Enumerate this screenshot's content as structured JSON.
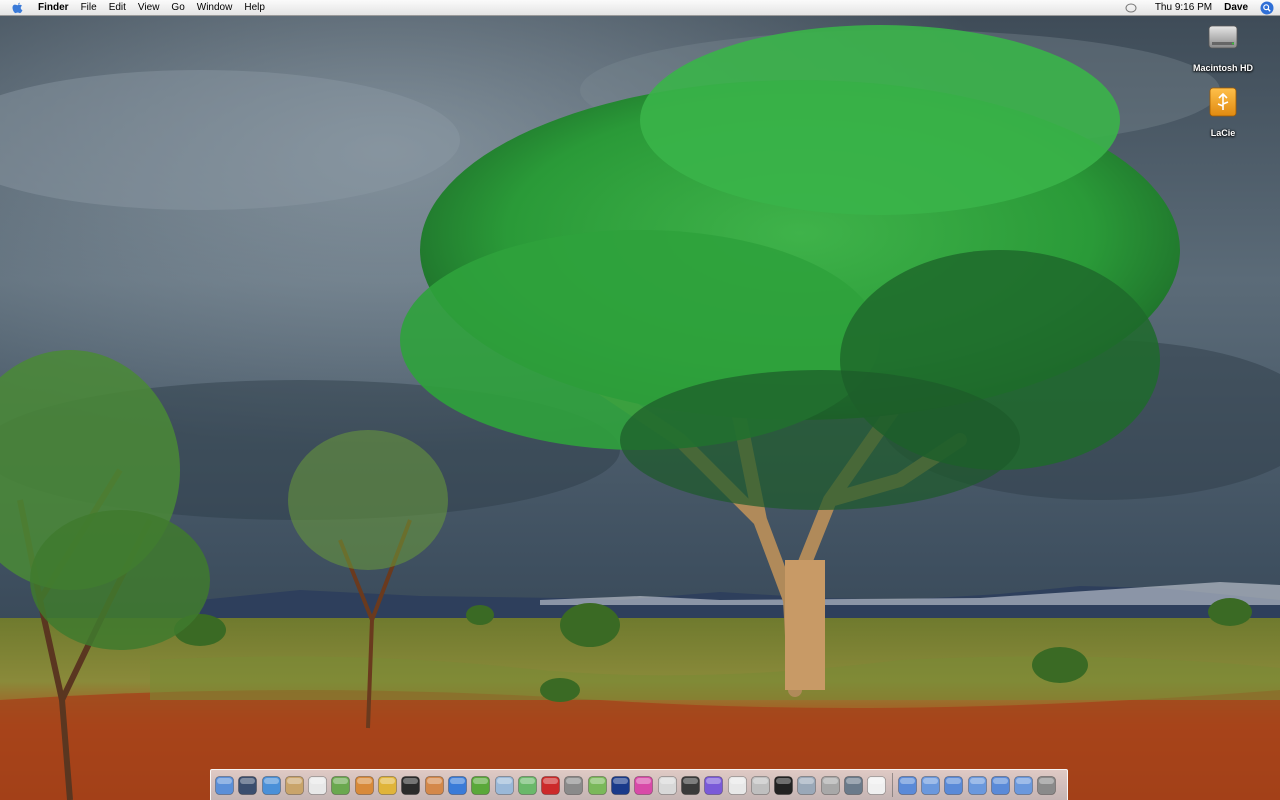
{
  "menubar": {
    "app_name": "Finder",
    "menus": [
      "File",
      "Edit",
      "View",
      "Go",
      "Window",
      "Help"
    ],
    "clock": "Thu 9:16 PM",
    "user": "Dave",
    "icons": [
      "apple-icon",
      "volume-icon",
      "spotlight-icon"
    ]
  },
  "desktop": {
    "icons": [
      {
        "label": "Macintosh HD",
        "icon": "hard-drive-icon"
      },
      {
        "label": "LaCie",
        "icon": "usb-drive-icon"
      }
    ],
    "wallpaper": "savanna-acacia-tree"
  },
  "dock": {
    "apps": [
      {
        "name": "finder-icon",
        "color": "#5b8fd8"
      },
      {
        "name": "dashboard-icon",
        "color": "#3b4e6e"
      },
      {
        "name": "safari-icon",
        "color": "#4a90d8"
      },
      {
        "name": "address-book-icon",
        "color": "#c9a46a"
      },
      {
        "name": "ical-icon",
        "color": "#e8e8e8"
      },
      {
        "name": "itunes-icon",
        "color": "#6aa84f"
      },
      {
        "name": "iphoto-icon",
        "color": "#d88a3a"
      },
      {
        "name": "app-yellow-icon",
        "color": "#e0b43a"
      },
      {
        "name": "word-icon",
        "color": "#2b2b2b"
      },
      {
        "name": "pages-icon",
        "color": "#d4884a"
      },
      {
        "name": "wiki-icon",
        "color": "#3a7bd8"
      },
      {
        "name": "app-green-icon",
        "color": "#5aa83a"
      },
      {
        "name": "textedit-icon",
        "color": "#9ab8d8"
      },
      {
        "name": "download-icon",
        "color": "#6ab86a"
      },
      {
        "name": "app-red-icon",
        "color": "#cc2a2a"
      },
      {
        "name": "app-dial-icon",
        "color": "#8a8a8a"
      },
      {
        "name": "preview-icon",
        "color": "#7ab85a"
      },
      {
        "name": "star-icon",
        "color": "#1a3a8a"
      },
      {
        "name": "flower-icon",
        "color": "#d84aa8"
      },
      {
        "name": "clipboard-icon",
        "color": "#d8d8d8"
      },
      {
        "name": "clapper-icon",
        "color": "#3a3a3a"
      },
      {
        "name": "app-purple-icon",
        "color": "#7a5ad8"
      },
      {
        "name": "notes-icon",
        "color": "#e8e8e8"
      },
      {
        "name": "calculator-icon",
        "color": "#bfbfbf"
      },
      {
        "name": "terminal-icon",
        "color": "#222222"
      },
      {
        "name": "network-icon",
        "color": "#9aa8b8"
      },
      {
        "name": "system-preferences-icon",
        "color": "#a8a8a8"
      },
      {
        "name": "utility-icon",
        "color": "#6a7a8a"
      },
      {
        "name": "app-white-icon",
        "color": "#f0f0f0"
      }
    ],
    "stacks": [
      {
        "name": "folder-icon-1",
        "color": "#5a8ad8"
      },
      {
        "name": "folder-icon-2",
        "color": "#6a98dd"
      },
      {
        "name": "folder-icon-3",
        "color": "#5a8ad8"
      },
      {
        "name": "folder-icon-4",
        "color": "#6a98dd"
      },
      {
        "name": "folder-icon-5",
        "color": "#5a8ad8"
      },
      {
        "name": "folder-icon-6",
        "color": "#6a98dd"
      },
      {
        "name": "trash-icon",
        "color": "#8a8a8a"
      }
    ]
  }
}
